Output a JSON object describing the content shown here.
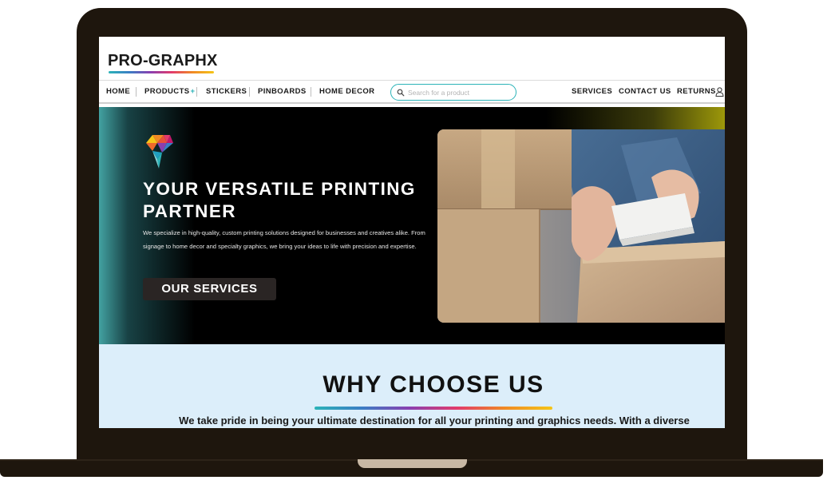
{
  "site": {
    "logo_text": "PRO-GRAPHX"
  },
  "nav": {
    "items": [
      {
        "label": "HOME"
      },
      {
        "label": "PRODUCTS",
        "suffix": "+"
      },
      {
        "label": "STICKERS"
      },
      {
        "label": "PINBOARDS"
      },
      {
        "label": "HOME DECOR"
      }
    ],
    "right_items": [
      {
        "label": "SERVICES"
      },
      {
        "label": "CONTACT US"
      },
      {
        "label": "RETURNS"
      }
    ]
  },
  "search": {
    "placeholder": "Search for a product",
    "value": ""
  },
  "hero": {
    "title": "YOUR VERSATILE PRINTING PARTNER",
    "description": "We specialize in high-quality, custom printing solutions designed for businesses and creatives alike. From signage to home decor and specialty graphics, we bring your ideas to life with precision and expertise.",
    "button_label": "OUR SERVICES"
  },
  "why": {
    "title": "WHY CHOOSE US",
    "text": "We take pride in being your ultimate destination for all your printing and graphics needs. With a diverse"
  },
  "icons": {
    "search": "search-icon",
    "user": "user-icon",
    "brand_mark": "brand-mark-icon"
  },
  "colors": {
    "accent": "#2bb3b8",
    "hero_bg": "#000000",
    "why_bg": "#dceefa",
    "button_bg": "#2a2524"
  }
}
